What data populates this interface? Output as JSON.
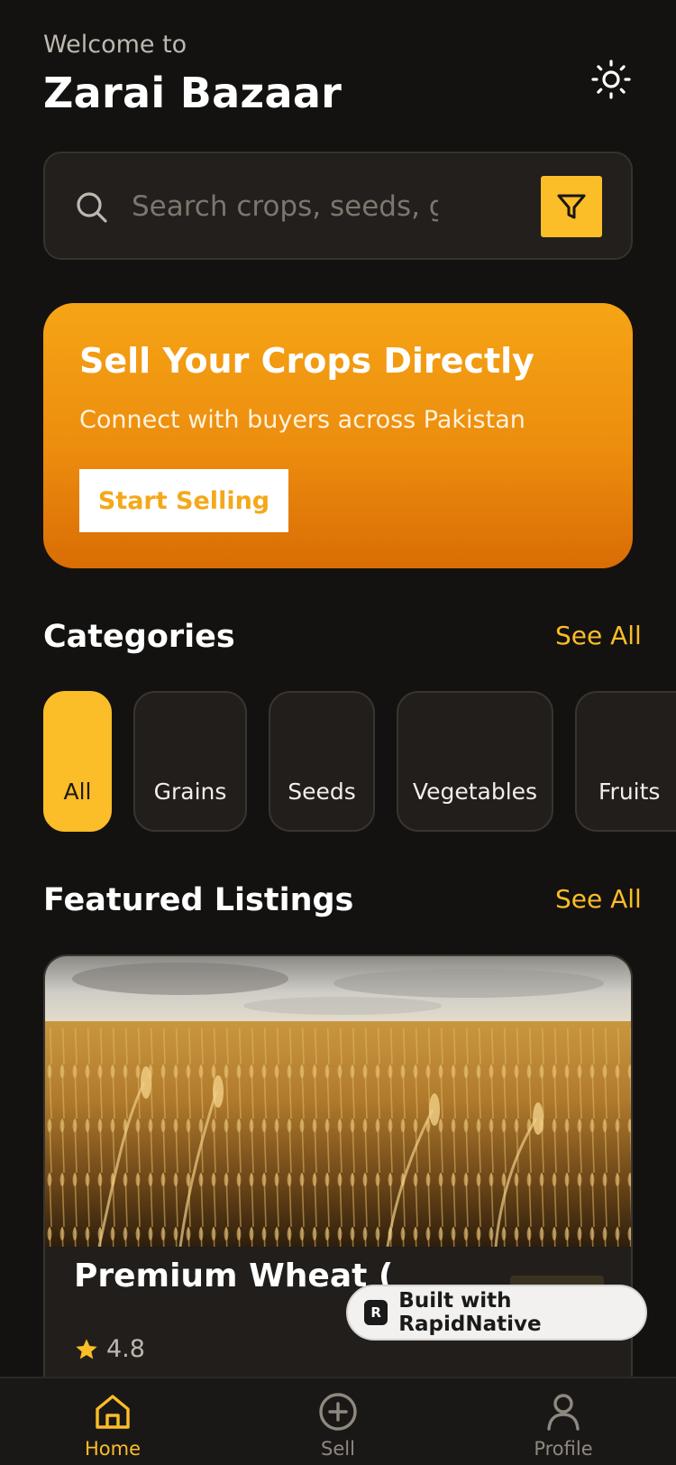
{
  "header": {
    "welcome": "Welcome to",
    "title": "Zarai Bazaar",
    "theme_icon": "sun-icon"
  },
  "search": {
    "placeholder": "Search crops, seeds, grains...",
    "search_icon": "search-icon",
    "filter_icon": "filter-icon"
  },
  "hero": {
    "title": "Sell Your Crops Directly",
    "subtitle": "Connect with buyers across Pakistan",
    "button_label": "Start Selling"
  },
  "categories": {
    "title": "Categories",
    "see_all": "See All",
    "items": [
      {
        "label": "All",
        "active": true
      },
      {
        "label": "Grains",
        "active": false
      },
      {
        "label": "Seeds",
        "active": false
      },
      {
        "label": "Vegetables",
        "active": false
      },
      {
        "label": "Fruits",
        "active": false
      }
    ]
  },
  "featured": {
    "title": "Featured Listings",
    "see_all": "See All",
    "listings": [
      {
        "title": "Premium Wheat (",
        "rating": "4.8"
      }
    ]
  },
  "badge": {
    "label": "Built with RapidNative"
  },
  "nav": {
    "items": [
      {
        "label": "Home",
        "icon": "home-icon",
        "active": true
      },
      {
        "label": "Sell",
        "icon": "plus-circle-icon",
        "active": false
      },
      {
        "label": "Profile",
        "icon": "user-icon",
        "active": false
      }
    ]
  },
  "colors": {
    "accent": "#fbbd28",
    "background": "#141210",
    "card": "#211e1b",
    "hero_top": "#f6a415",
    "hero_bottom": "#d96d05"
  }
}
